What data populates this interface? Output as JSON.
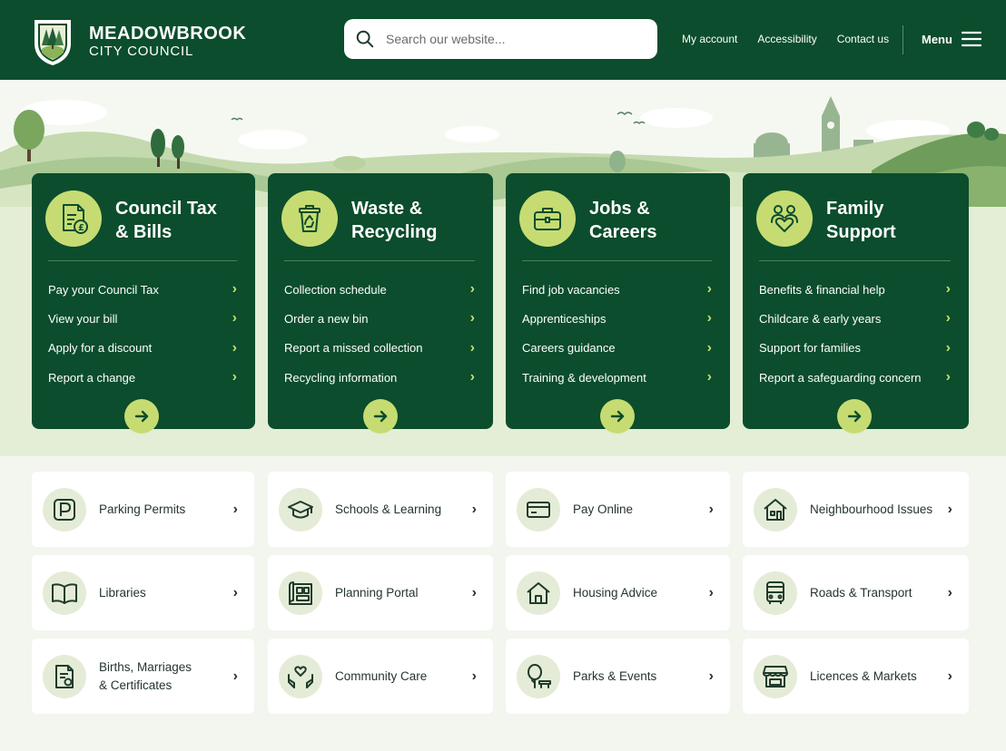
{
  "header": {
    "logo_line1": "MEADOWBROOK",
    "logo_line2": "CITY COUNCIL",
    "search_placeholder": "Search our website...",
    "links": [
      "My account",
      "Accessibility",
      "Contact us"
    ],
    "menu_label": "Menu"
  },
  "cards": [
    {
      "title_line1": "Council Tax",
      "title_line2": "& Bills",
      "icon": "council-tax-document-icon",
      "links": [
        "Pay your Council Tax",
        "View your bill",
        "Apply for a discount",
        "Report a change"
      ]
    },
    {
      "title_line1": "Waste &",
      "title_line2": "Recycling",
      "icon": "recycling-bin-icon",
      "links": [
        "Collection schedule",
        "Order a new bin",
        "Report a missed collection",
        "Recycling information"
      ]
    },
    {
      "title_line1": "Jobs &",
      "title_line2": "Careers",
      "icon": "briefcase-icon",
      "links": [
        "Find job vacancies",
        "Apprenticeships",
        "Careers guidance",
        "Training & development"
      ]
    },
    {
      "title_line1": "Family",
      "title_line2": "Support",
      "icon": "family-heart-icon",
      "links": [
        "Benefits & financial help",
        "Childcare & early years",
        "Support for families",
        "Report a safeguarding concern"
      ]
    }
  ],
  "tiles": [
    {
      "label": "Parking Permits",
      "icon": "parking-icon"
    },
    {
      "label": "Schools & Learning",
      "icon": "graduation-cap-icon"
    },
    {
      "label": "Pay Online",
      "icon": "credit-card-icon"
    },
    {
      "label": "Neighbourhood Issues",
      "icon": "neighbourhood-house-icon"
    },
    {
      "label": "Libraries",
      "icon": "book-icon"
    },
    {
      "label": "Planning Portal",
      "icon": "planning-blueprint-icon"
    },
    {
      "label": "Housing Advice",
      "icon": "house-icon"
    },
    {
      "label": "Roads & Transport",
      "icon": "bus-icon"
    },
    {
      "label": "Births, Marriages\n& Certificates",
      "label_line1": "Births, Marriages",
      "label_line2": "& Certificates",
      "icon": "certificate-icon"
    },
    {
      "label": "Community Care",
      "icon": "care-hands-icon"
    },
    {
      "label": "Parks & Events",
      "icon": "park-tree-icon"
    },
    {
      "label": "Licences & Markets",
      "icon": "market-stall-icon"
    }
  ],
  "colors": {
    "brand_green": "#0b4d2c",
    "accent_lime": "#c6dc72",
    "page_background": "#f3f6ee"
  }
}
